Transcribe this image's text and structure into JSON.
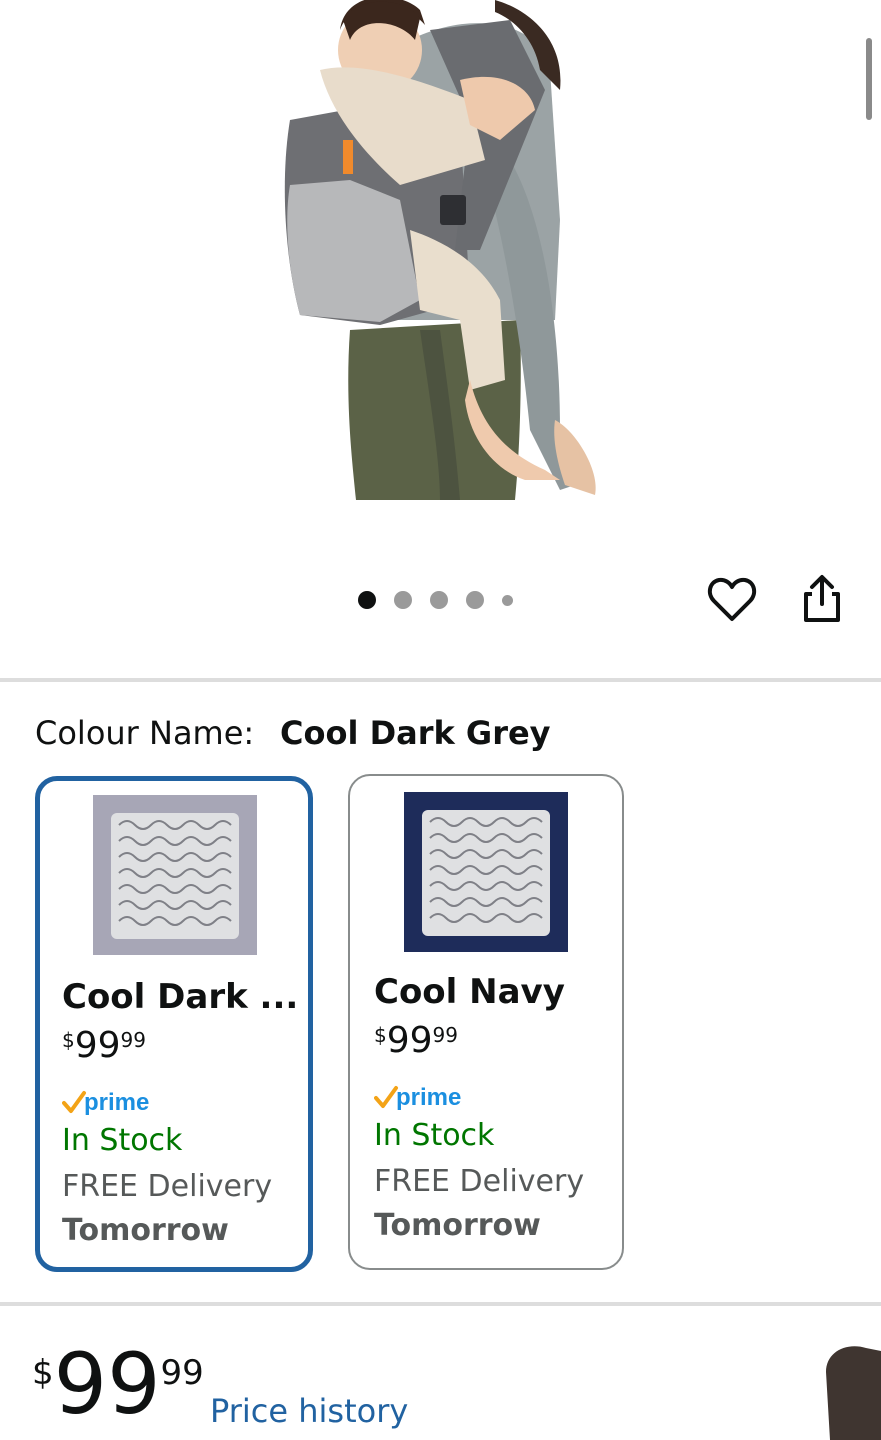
{
  "product": {
    "image_alt": "Adult carrying toddler in baby carrier",
    "image_count": 5,
    "active_image": 1
  },
  "actions": {
    "wishlist_icon": "heart-icon",
    "share_icon": "share-icon"
  },
  "variation": {
    "label": "Colour Name:",
    "selected_value": "Cool Dark Grey",
    "options": [
      {
        "name": "Cool Dark ...",
        "price_currency": "$",
        "price_whole": "99",
        "price_cents": "99",
        "prime": "prime",
        "stock": "In Stock",
        "delivery": "FREE Delivery",
        "delivery_day": "Tomorrow",
        "swatch_color": "#a7a6b6",
        "selected": true
      },
      {
        "name": "Cool Navy",
        "price_currency": "$",
        "price_whole": "99",
        "price_cents": "99",
        "prime": "prime",
        "stock": "In Stock",
        "delivery": "FREE Delivery",
        "delivery_day": "Tomorrow",
        "swatch_color": "#1e2c5a",
        "selected": false
      }
    ]
  },
  "price": {
    "currency": "$",
    "whole": "99",
    "cents": "99",
    "history_link": "Price history"
  },
  "colors": {
    "selected_border": "#2162a1",
    "in_stock": "#007600",
    "link": "#2162a1",
    "prime_blue": "#1b8fe0",
    "prime_check": "#f3a317"
  }
}
